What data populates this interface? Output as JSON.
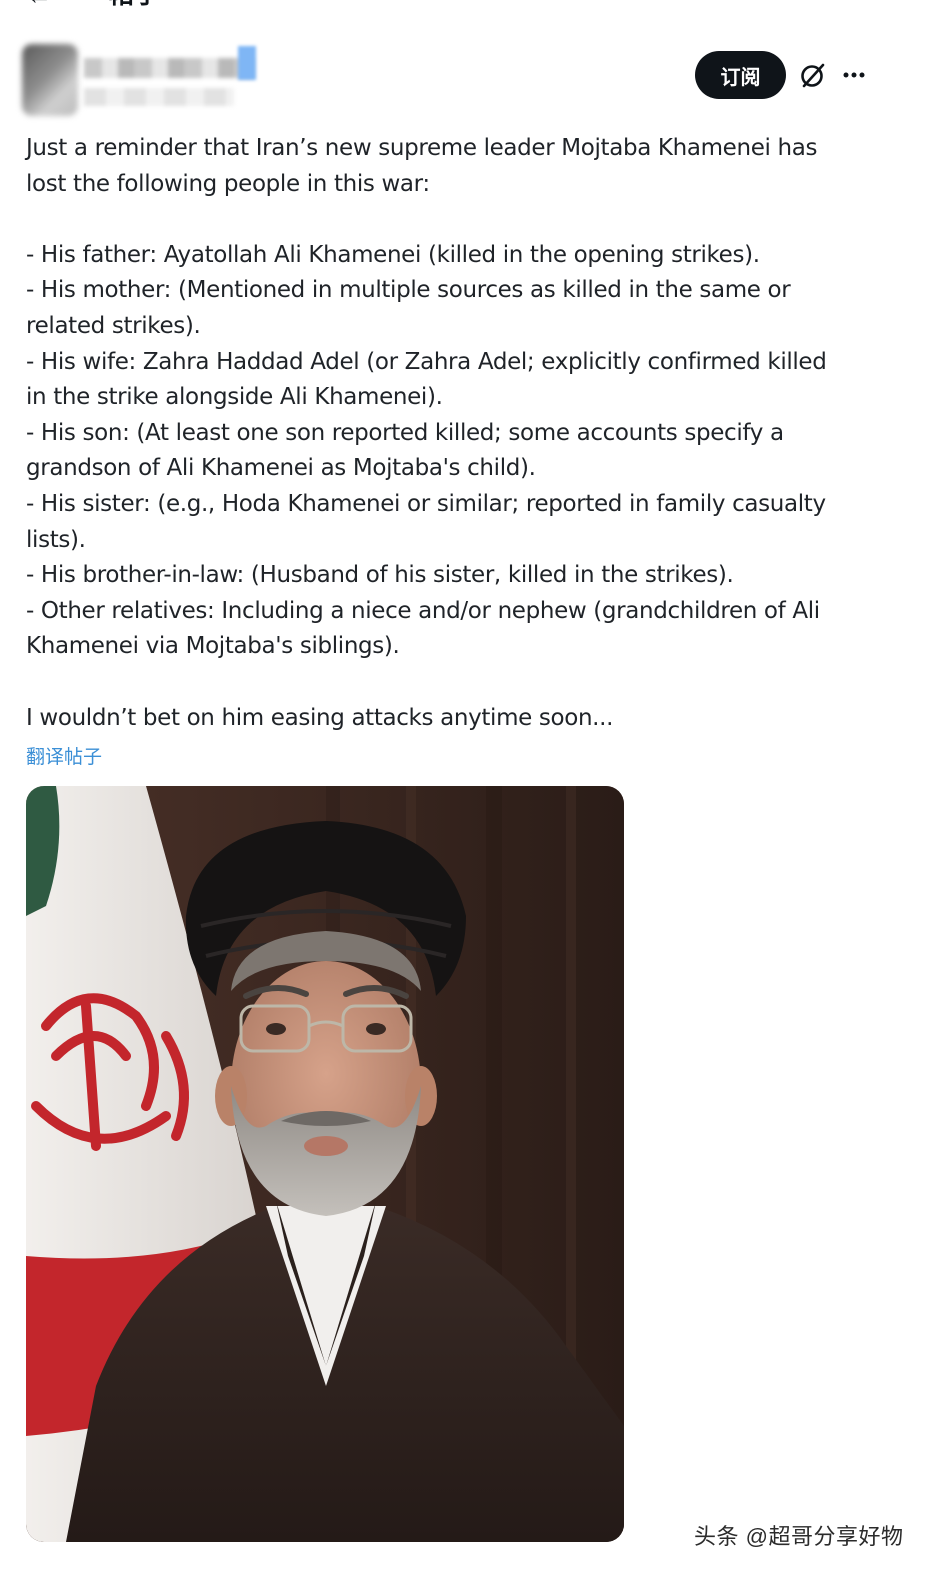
{
  "header": {
    "back_icon": "arrow-left-icon",
    "title": "帖子"
  },
  "author": {
    "display_name": "",
    "handle": "",
    "note": "blurred"
  },
  "actions": {
    "subscribe_label": "订阅",
    "grok_icon": "grok-icon",
    "more_icon": "more-icon"
  },
  "post": {
    "lines": [
      "Just a reminder that Iran’s new supreme leader Mojtaba Khamenei has",
      "lost the following people in this war:",
      "",
      "- His father: Ayatollah Ali Khamenei (killed in the opening strikes).",
      "- His mother: (Mentioned in multiple sources as killed in the same or",
      "related strikes).",
      "- His wife: Zahra Haddad Adel (or Zahra Adel; explicitly confirmed killed",
      "in the strike alongside Ali Khamenei).",
      "- His son: (At least one son reported killed; some accounts specify a",
      "grandson of Ali Khamenei as Mojtaba's child).",
      "- His sister: (e.g., Hoda Khamenei or similar; reported in family casualty",
      "lists).",
      "- His brother-in-law: (Husband of his sister, killed in the strikes).",
      "- Other relatives: Including a niece and/or nephew (grandchildren of Ali",
      "Khamenei via Mojtaba's siblings).",
      "",
      "I wouldn’t bet on him easing attacks anytime soon..."
    ],
    "translate_label": "翻译帖子"
  },
  "media": {
    "colors": {
      "background": "#3d2a22",
      "flag_white": "#ece9e6",
      "flag_red": "#c3262c",
      "flag_green": "#2f5a42",
      "turban": "#151313",
      "robe": "#2e2320",
      "skin": "#c9957c",
      "beard": "#a7a39e"
    }
  },
  "watermark": "头条 @超哥分享好物"
}
